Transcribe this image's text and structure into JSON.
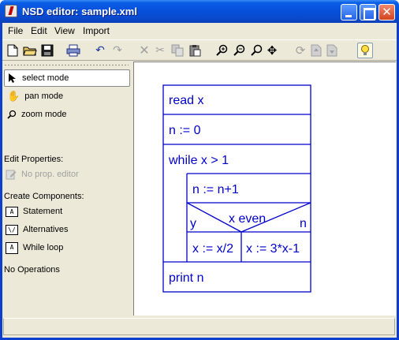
{
  "window": {
    "title": "NSD editor: sample.xml"
  },
  "menubar": {
    "items": [
      "File",
      "Edit",
      "View",
      "Import"
    ]
  },
  "toolbar": {
    "icons": [
      "new-file-icon",
      "open-folder-icon",
      "save-icon",
      "print-icon",
      "undo-icon",
      "redo-icon",
      "delete-icon",
      "cut-icon",
      "copy-icon",
      "paste-icon",
      "zoom-in-icon",
      "zoom-out-icon",
      "zoom-icon",
      "move-icon",
      "refresh-icon",
      "move-up-icon",
      "move-down-icon",
      "hint-icon"
    ]
  },
  "modes": {
    "select": "select mode",
    "pan": "pan mode",
    "zoom": "zoom mode",
    "selected": "select mode"
  },
  "edit_properties": {
    "label": "Edit Properties:",
    "editor": "No prop. editor"
  },
  "create_components": {
    "label": "Create Components:",
    "items": [
      "Statement",
      "Alternatives",
      "While loop"
    ]
  },
  "operations": {
    "label": "No Operations"
  },
  "diagram": {
    "color": "#0000cc",
    "blocks": {
      "read": "read x",
      "init": "n := 0",
      "loop": "while x > 1",
      "inc": "n := n+1",
      "cond": "x even",
      "yes": "y",
      "no": "n",
      "then": "x := x/2",
      "else": "x := 3*x-1",
      "print": "print n"
    }
  },
  "statusbar": {
    "text": ""
  }
}
